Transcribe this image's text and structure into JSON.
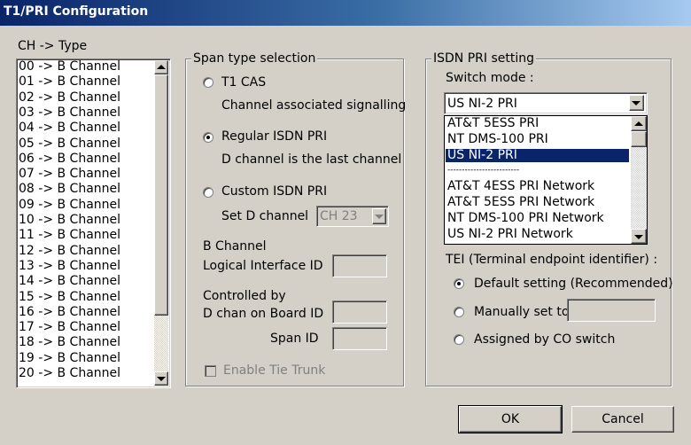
{
  "window": {
    "title": "T1/PRI Configuration"
  },
  "channel_list": {
    "header": "CH   -> Type",
    "items": [
      "00 -> B Channel",
      "01 -> B Channel",
      "02 -> B Channel",
      "03 -> B Channel",
      "04 -> B Channel",
      "05 -> B Channel",
      "06 -> B Channel",
      "07 -> B Channel",
      "08 -> B Channel",
      "09 -> B Channel",
      "10 -> B Channel",
      "11 -> B Channel",
      "12 -> B Channel",
      "13 -> B Channel",
      "14 -> B Channel",
      "15 -> B Channel",
      "16 -> B Channel",
      "17 -> B Channel",
      "18 -> B Channel",
      "19 -> B Channel",
      "20 -> B Channel"
    ]
  },
  "span": {
    "legend": "Span type selection",
    "t1cas_label": "T1 CAS",
    "t1cas_desc": "Channel associated signalling",
    "regular_label": "Regular ISDN PRI",
    "regular_desc": "D channel is the last channel",
    "custom_label": "Custom ISDN PRI",
    "setd_label": "Set D channel",
    "setd_value": "CH 23",
    "bchan_label": "B Channel",
    "logical_label": "Logical Interface ID",
    "controlled_label": "Controlled by",
    "dchan_board_label": "D chan on Board ID",
    "spanid_label": "Span ID",
    "tie_trunk_label": "Enable Tie Trunk",
    "selected": "regular"
  },
  "isdn": {
    "legend": "ISDN PRI setting",
    "switch_mode_label": "Switch mode :",
    "switch_mode_value": "US NI-2 PRI",
    "options": [
      "AT&T 5ESS PRI",
      "NT DMS-100 PRI",
      "US NI-2 PRI",
      "-------------------------",
      "AT&T 4ESS PRI Network",
      "AT&T 5ESS PRI Network",
      "NT DMS-100 PRI Network",
      "US NI-2 PRI Network"
    ],
    "selected_option": "US NI-2 PRI",
    "tei_label": "TEI (Terminal endpoint identifier) :",
    "tei_default": "Default setting (Recommended)",
    "tei_manual": "Manually set to",
    "tei_co": "Assigned by CO switch",
    "tei_selected": "default"
  },
  "buttons": {
    "ok": "OK",
    "cancel": "Cancel"
  },
  "colors": {
    "title_start": "#0a246a",
    "title_end": "#a6caf0",
    "selection": "#0a246a",
    "face": "#d4d0c8"
  }
}
